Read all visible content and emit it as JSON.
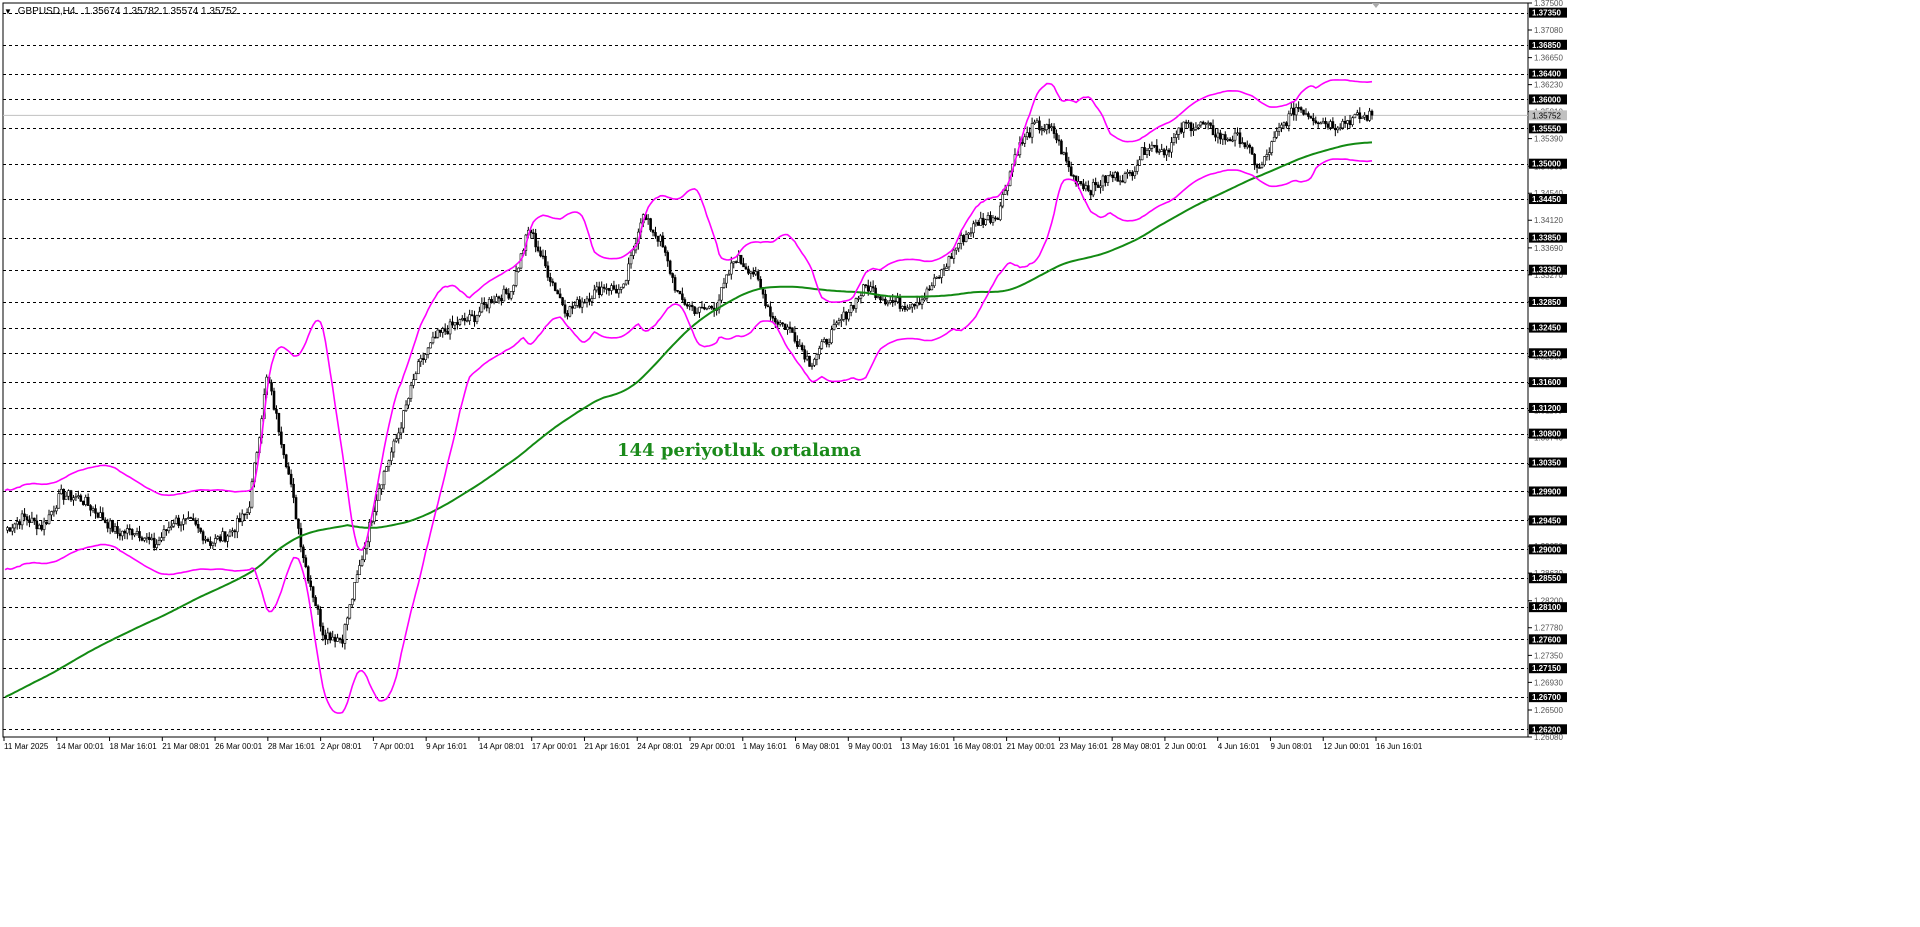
{
  "symbol": {
    "label": "GBPUSD,H4",
    "ohlc": "1.35674 1.35782 1.35574 1.35752"
  },
  "annotation": {
    "text": "144 periyotluk ortalama"
  },
  "colors": {
    "candles": "#000000",
    "bollinger": "#ff00ff",
    "moving_average": "#138a13",
    "grid": "#000000",
    "background": "#ffffff",
    "price_label_bg": "#000000",
    "price_label_text": "#ffffff"
  },
  "chart_data": {
    "type": "candlestick",
    "title": "",
    "symbol": "GBPUSD",
    "timeframe": "H4",
    "ylim": [
      1.2608,
      1.375
    ],
    "current_price": 1.35752,
    "y_ticks": [
      "1.37500",
      "1.37080",
      "1.36650",
      "1.36230",
      "1.35810",
      "1.35390",
      "1.34960",
      "1.34540",
      "1.34120",
      "1.33690",
      "1.33270",
      "1.32850",
      "1.32430",
      "1.32000",
      "1.31580",
      "1.31160",
      "1.30740",
      "1.30320",
      "1.29890",
      "1.29470",
      "1.29050",
      "1.28630",
      "1.28200",
      "1.27780",
      "1.27350",
      "1.26930",
      "1.26500",
      "1.26080"
    ],
    "horizontal_levels": [
      "1.37350",
      "1.36850",
      "1.36400",
      "1.36000",
      "1.35550",
      "1.35000",
      "1.34450",
      "1.33850",
      "1.33350",
      "1.32850",
      "1.32450",
      "1.32050",
      "1.31600",
      "1.31200",
      "1.30800",
      "1.30350",
      "1.29900",
      "1.29450",
      "1.29000",
      "1.28550",
      "1.28100",
      "1.27600",
      "1.27150",
      "1.26700",
      "1.26200"
    ],
    "x_labels": [
      "11 Mar 2025",
      "14 Mar 00:01",
      "18 Mar 16:01",
      "21 Mar 08:01",
      "26 Mar 00:01",
      "28 Mar 16:01",
      "2 Apr 08:01",
      "7 Apr 00:01",
      "9 Apr 16:01",
      "14 Apr 08:01",
      "17 Apr 00:01",
      "21 Apr 16:01",
      "24 Apr 08:01",
      "29 Apr 00:01",
      "1 May 16:01",
      "6 May 08:01",
      "9 May 00:01",
      "13 May 16:01",
      "16 May 08:01",
      "21 May 00:01",
      "23 May 16:01",
      "28 May 08:01",
      "2 Jun 00:01",
      "4 Jun 16:01",
      "9 Jun 08:01",
      "12 Jun 00:01",
      "16 Jun 16:01"
    ],
    "price_anchors": [
      [
        "11 Mar 2025",
        1.293
      ],
      [
        "12 Mar",
        1.295
      ],
      [
        "14 Mar 00:01",
        1.2935
      ],
      [
        "17 Mar",
        1.2985
      ],
      [
        "18 Mar 16:01",
        1.298
      ],
      [
        "20 Mar",
        1.2955
      ],
      [
        "21 Mar 08:01",
        1.2925
      ],
      [
        "24 Mar",
        1.293
      ],
      [
        "26 Mar 00:01",
        1.2905
      ],
      [
        "27 Mar",
        1.2945
      ],
      [
        "28 Mar 16:01",
        1.294
      ],
      [
        "31 Mar",
        1.291
      ],
      [
        "1 Apr",
        1.2925
      ],
      [
        "2 Apr 08:01",
        1.296
      ],
      [
        "3 Apr",
        1.317
      ],
      [
        "4 Apr",
        1.304
      ],
      [
        "4 Apr late",
        1.288
      ],
      [
        "7 Apr 00:01",
        1.277
      ],
      [
        "8 Apr",
        1.276
      ],
      [
        "9 Apr 16:01",
        1.288
      ],
      [
        "10 Apr",
        1.3
      ],
      [
        "11 Apr",
        1.308
      ],
      [
        "14 Apr 08:01",
        1.318
      ],
      [
        "15 Apr",
        1.323
      ],
      [
        "16 Apr",
        1.325
      ],
      [
        "17 Apr 00:01",
        1.326
      ],
      [
        "17 Apr late",
        1.329
      ],
      [
        "18 Apr",
        1.33
      ],
      [
        "21 Apr 16:01",
        1.34
      ],
      [
        "22 Apr",
        1.333
      ],
      [
        "23 Apr",
        1.327
      ],
      [
        "24 Apr 08:01",
        1.329
      ],
      [
        "25 Apr",
        1.331
      ],
      [
        "28 Apr",
        1.33
      ],
      [
        "29 Apr 00:01",
        1.342
      ],
      [
        "30 Apr",
        1.338
      ],
      [
        "1 May 16:01",
        1.329
      ],
      [
        "2 May",
        1.327
      ],
      [
        "5 May",
        1.328
      ],
      [
        "6 May 08:01",
        1.3355
      ],
      [
        "7 May",
        1.333
      ],
      [
        "8 May",
        1.326
      ],
      [
        "9 May 00:01",
        1.324
      ],
      [
        "9 May late",
        1.319
      ],
      [
        "12 May",
        1.323
      ],
      [
        "13 May",
        1.327
      ],
      [
        "13 May 16:01",
        1.331
      ],
      [
        "14 May",
        1.329
      ],
      [
        "15 May",
        1.328
      ],
      [
        "16 May 08:01",
        1.329
      ],
      [
        "19 May",
        1.333
      ],
      [
        "20 May",
        1.338
      ],
      [
        "21 May 00:01",
        1.341
      ],
      [
        "22 May",
        1.342
      ],
      [
        "22 May late",
        1.352
      ],
      [
        "23 May 16:01",
        1.356
      ],
      [
        "26 May",
        1.355
      ],
      [
        "27 May",
        1.348
      ],
      [
        "28 May 08:01",
        1.346
      ],
      [
        "29 May",
        1.348
      ],
      [
        "30 May",
        1.348
      ],
      [
        "2 Jun 00:01",
        1.353
      ],
      [
        "3 Jun",
        1.352
      ],
      [
        "4 Jun 16:01",
        1.356
      ],
      [
        "5 Jun",
        1.356
      ],
      [
        "6 Jun",
        1.354
      ],
      [
        "9 Jun 08:01",
        1.354
      ],
      [
        "10 Jun",
        1.349
      ],
      [
        "11 Jun",
        1.355
      ],
      [
        "12 Jun 00:01",
        1.359
      ],
      [
        "13 Jun",
        1.357
      ],
      [
        "13 Jun late",
        1.356
      ],
      [
        "16 Jun",
        1.357
      ],
      [
        "16 Jun 16:01",
        1.3575
      ]
    ],
    "series": [
      {
        "name": "",
        "type": "moving_average",
        "period": 144,
        "color": "#138a13"
      },
      {
        "name": "",
        "type": "bollinger_upper",
        "color": "#ff00ff"
      },
      {
        "name": "",
        "type": "bollinger_lower",
        "color": "#ff00ff"
      }
    ],
    "grid": true
  }
}
